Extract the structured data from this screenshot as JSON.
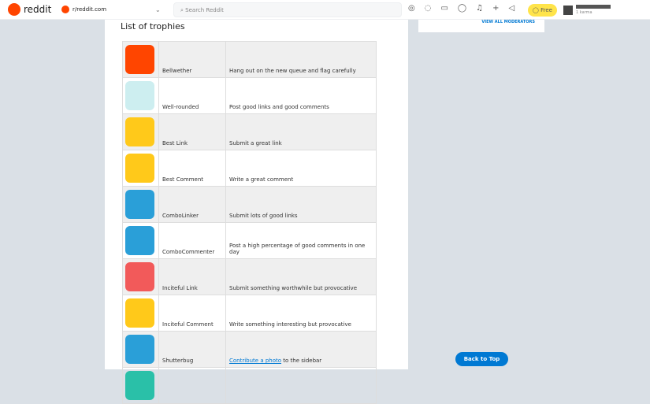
{
  "header": {
    "logo": "reddit",
    "community": "r/reddit.com",
    "search_placeholder": "Search Reddit",
    "free_label": "Free",
    "karma": "1 karma"
  },
  "sidebar": {
    "link": "VIEW ALL MODERATORS"
  },
  "main": {
    "title": "List of trophies",
    "trophies": [
      {
        "name": "Bellwether",
        "desc": "Hang out on the new queue and flag carefully",
        "color": "#ff4500"
      },
      {
        "name": "Well-rounded",
        "desc": "Post good links and good comments",
        "color": "#cdeef0"
      },
      {
        "name": "Best Link",
        "desc": "Submit a great link",
        "color": "#ffc91a"
      },
      {
        "name": "Best Comment",
        "desc": "Write a great comment",
        "color": "#ffc91a"
      },
      {
        "name": "ComboLinker",
        "desc": "Submit lots of good links",
        "color": "#2a9fd8"
      },
      {
        "name": "ComboCommenter",
        "desc": "Post a high percentage of good comments in one day",
        "color": "#2a9fd8"
      },
      {
        "name": "Inciteful Link",
        "desc": "Submit something worthwhile but provocative",
        "color": "#f25a5a"
      },
      {
        "name": "Inciteful Comment",
        "desc": "Write something interesting but provocative",
        "color": "#ffc91a"
      },
      {
        "name": "Shutterbug",
        "desc_link": "Contribute a photo",
        "desc": " to the sidebar",
        "color": "#2a9fd8"
      },
      {
        "name": "",
        "desc": "",
        "color": "#2ac0a8"
      }
    ]
  },
  "back_to_top": "Back to Top"
}
